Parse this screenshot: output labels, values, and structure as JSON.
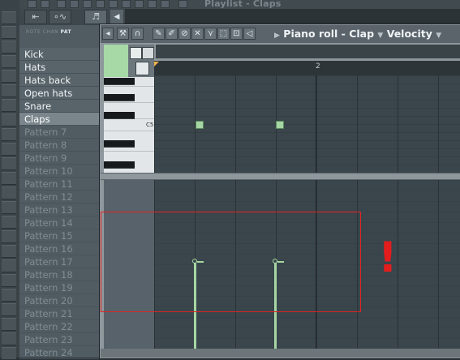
{
  "topbar": {
    "faint_title": "Playlist - Claps"
  },
  "browser": {
    "tabs": [
      "⇤",
      "∘∿",
      "♬"
    ],
    "rcp": [
      "ROTE",
      "CHAN",
      "PAT"
    ],
    "patterns": [
      {
        "label": "Kick",
        "state": "active"
      },
      {
        "label": "Hats",
        "state": "active"
      },
      {
        "label": "Hats back",
        "state": "active"
      },
      {
        "label": "Open hats",
        "state": "active"
      },
      {
        "label": "Snare",
        "state": "active"
      },
      {
        "label": "Claps",
        "state": "selected"
      },
      {
        "label": "Pattern 7",
        "state": "inactive"
      },
      {
        "label": "Pattern 8",
        "state": "inactive"
      },
      {
        "label": "Pattern 9",
        "state": "inactive"
      },
      {
        "label": "Pattern 10",
        "state": "inactive"
      },
      {
        "label": "Pattern 11",
        "state": "inactive"
      },
      {
        "label": "Pattern 12",
        "state": "inactive"
      },
      {
        "label": "Pattern 13",
        "state": "inactive"
      },
      {
        "label": "Pattern 14",
        "state": "inactive"
      },
      {
        "label": "Pattern 15",
        "state": "inactive"
      },
      {
        "label": "Pattern 16",
        "state": "inactive"
      },
      {
        "label": "Pattern 17",
        "state": "inactive"
      },
      {
        "label": "Pattern 18",
        "state": "inactive"
      },
      {
        "label": "Pattern 19",
        "state": "inactive"
      },
      {
        "label": "Pattern 20",
        "state": "inactive"
      },
      {
        "label": "Pattern 21",
        "state": "inactive"
      },
      {
        "label": "Pattern 22",
        "state": "inactive"
      },
      {
        "label": "Pattern 23",
        "state": "inactive"
      },
      {
        "label": "Pattern 24",
        "state": "inactive"
      }
    ]
  },
  "piano_roll": {
    "title": "Piano roll - Clap",
    "target": "Velocity",
    "ruler_bar_label": "2",
    "key_label": "C5",
    "toolbar_icons": [
      "menu-arrow-icon",
      "wrench-icon",
      "magnet-icon",
      "draw-icon",
      "paint-icon",
      "delete-icon",
      "mute-icon",
      "slice-icon",
      "select-icon",
      "zoom-icon",
      "playback-icon"
    ],
    "colors": {
      "note": "#a6d6a4",
      "highlight": "#e02323"
    }
  },
  "annotation": {
    "exclamation": "!"
  }
}
